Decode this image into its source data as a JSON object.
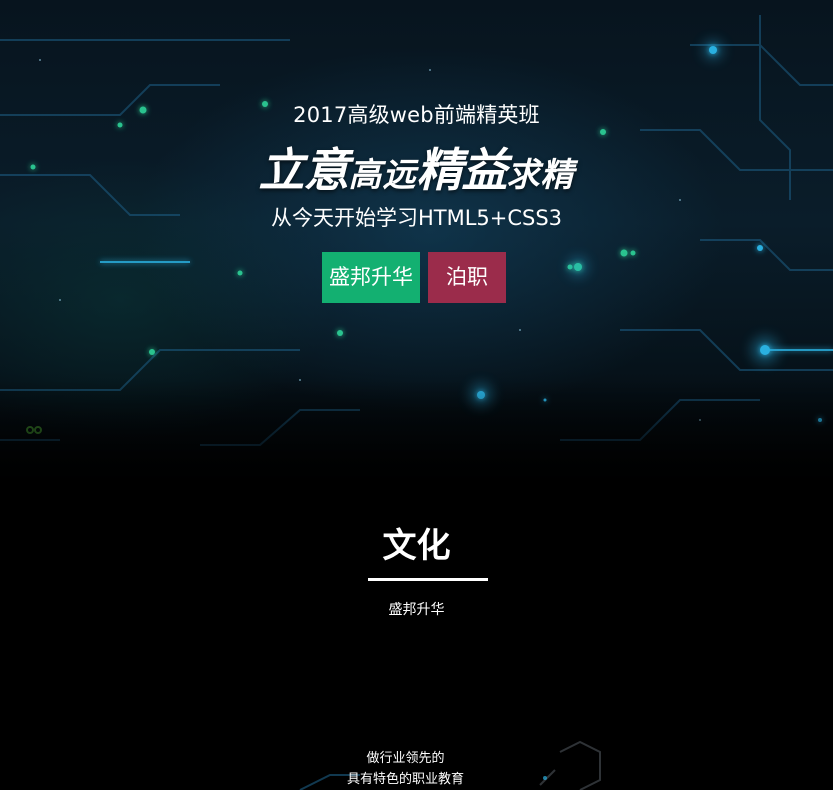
{
  "hero": {
    "subtitle": "2017高级web前端精英班",
    "slogan": {
      "part1": "立意",
      "part2": "高远",
      "part3": "精益",
      "part4": "求精"
    },
    "tagline": "从今天开始学习HTML5+CSS3",
    "buttons": {
      "primary_label": "盛邦升华",
      "secondary_label": "泊职"
    }
  },
  "section": {
    "title": "文化",
    "subtitle": "盛邦升华"
  },
  "bottom": {
    "line1": "做行业领先的",
    "line2": "具有特色的职业教育"
  },
  "colors": {
    "primary_button": "#13b071",
    "secondary_button": "#9b2c4b",
    "background": "#000000",
    "circuit_blue": "#1fa6d6",
    "circuit_green": "#3fd69a"
  }
}
